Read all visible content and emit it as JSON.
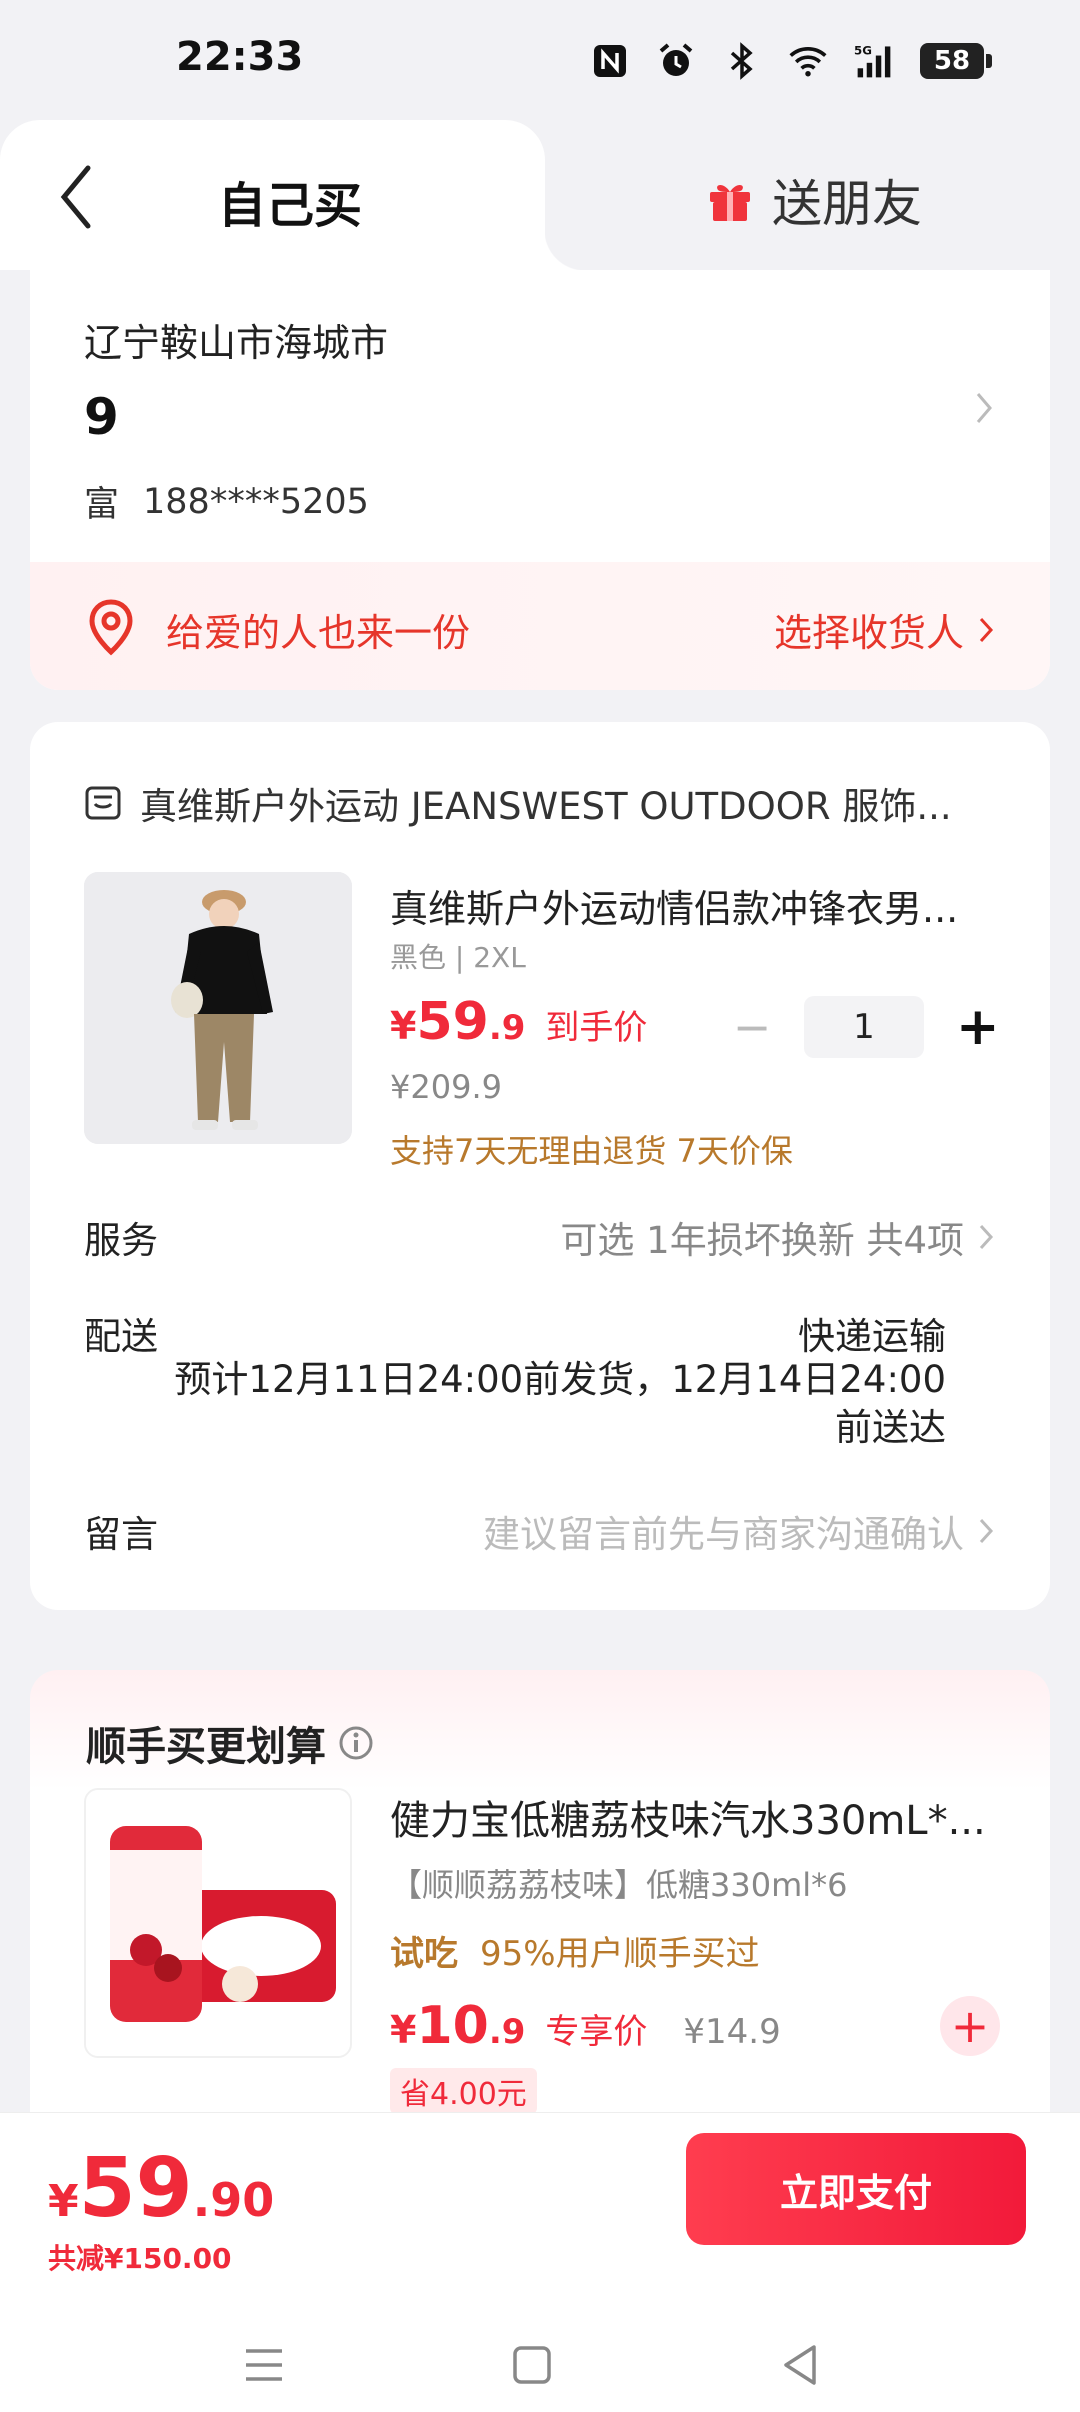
{
  "status": {
    "time": "22:33",
    "battery": "58",
    "signal": "5G"
  },
  "tabs": {
    "self_buy": "自己买",
    "gift": "送朋友"
  },
  "address": {
    "city": "辽宁鞍山市海城市",
    "detail": "9",
    "name": "富",
    "phone": "188****5205",
    "gift_prompt": "给爱的人也来一份",
    "select_receiver": "选择收货人"
  },
  "order": {
    "shop_name": "真维斯户外运动 JEANSWEST OUTDOOR 服饰...",
    "product": {
      "title": "真维斯户外运动情侣款冲锋衣男...",
      "spec": "黑色 | 2XL",
      "price_currency": "¥",
      "price_int": "59",
      "price_dec": ".9",
      "price_tag": "到手价",
      "original_price": "¥209.9",
      "guarantee": "支持7天无理由退货 7天价保",
      "quantity": "1"
    },
    "service_label": "服务",
    "service_value": "可选 1年损坏换新 共4项",
    "delivery_label": "配送",
    "delivery_type": "快递运输",
    "delivery_estimate": "预计12月11日24:00前发货，12月14日24:00前送达",
    "message_label": "留言",
    "message_placeholder": "建议留言前先与商家沟通确认"
  },
  "bundle": {
    "title": "顺手买更划算",
    "product": {
      "name": "健力宝低糖荔枝味汽水330mL*...",
      "spec": "【顺顺荔荔枝味】低糖330ml*6",
      "trial": "试吃",
      "trial_stat": "95%用户顺手买过",
      "price_currency": "¥",
      "price_int": "10",
      "price_dec": ".9",
      "price_tag": "专享价",
      "original_price": "¥14.9",
      "save": "省4.00元"
    }
  },
  "checkout": {
    "currency": "¥",
    "total_int": "59",
    "total_dec": ".90",
    "discount": "共减¥150.00",
    "pay_button": "立即支付"
  },
  "colors": {
    "accent": "#f02a3a",
    "gold": "#b8792c"
  }
}
